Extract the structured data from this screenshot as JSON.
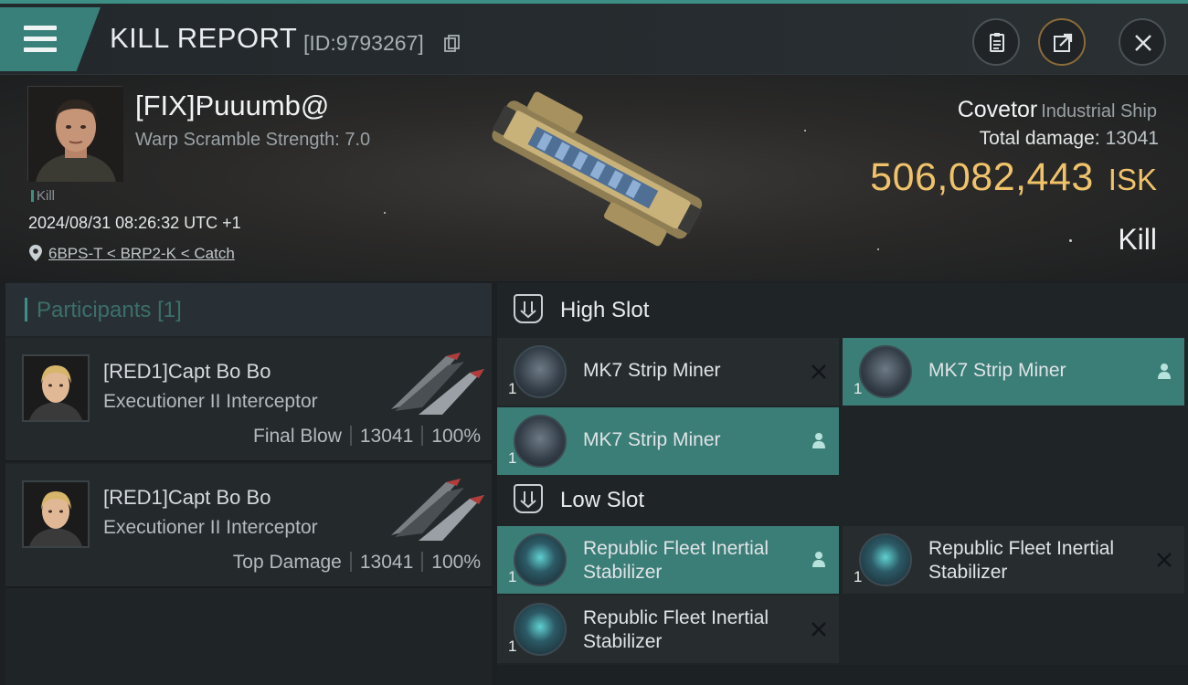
{
  "header": {
    "title": "KILL REPORT",
    "id_text": "[ID:9793267]"
  },
  "victim": {
    "name": "[FIX]Puuumb@",
    "warp_info": "Warp Scramble Strength: 7.0",
    "kill_tag": "Kill",
    "timestamp": "2024/08/31 08:26:32 UTC +1",
    "location": "6BPS-T < BRP2-K < Catch",
    "ship_name": "Covetor",
    "ship_class": "Industrial Ship",
    "total_damage_label": "Total damage:",
    "total_damage": "13041",
    "isk_value": "506,082,443",
    "isk_unit": "ISK",
    "result": "Kill"
  },
  "participants": {
    "label": "Participants",
    "count": "[1]",
    "items": [
      {
        "name": "[RED1]Capt Bo Bo",
        "ship": "Executioner II Interceptor",
        "role": "Final Blow",
        "damage": "13041",
        "percent": "100%"
      },
      {
        "name": "[RED1]Capt Bo Bo",
        "ship": "Executioner II Interceptor",
        "role": "Top Damage",
        "damage": "13041",
        "percent": "100%"
      }
    ]
  },
  "slots": {
    "high": {
      "label": "High Slot",
      "modules": [
        {
          "name": "MK7 Strip Miner",
          "qty": "1",
          "status": "destroyed-x-icon",
          "highlighted": false
        },
        {
          "name": "MK7 Strip Miner",
          "qty": "1",
          "status": "dropped-person-icon",
          "highlighted": true
        },
        {
          "name": "MK7 Strip Miner",
          "qty": "1",
          "status": "dropped-person-icon",
          "highlighted": true
        }
      ]
    },
    "low": {
      "label": "Low Slot",
      "modules": [
        {
          "name_line1": "Republic Fleet Inertial",
          "name_line2": "Stabilizer",
          "qty": "1",
          "status": "dropped-person-icon",
          "highlighted": true
        },
        {
          "name_line1": "Republic Fleet Inertial",
          "name_line2": "Stabilizer",
          "qty": "1",
          "status": "destroyed-x-icon",
          "highlighted": false
        },
        {
          "name_line1": "Republic Fleet Inertial",
          "name_line2": "Stabilizer",
          "qty": "1",
          "status": "destroyed-x-icon",
          "highlighted": false
        }
      ]
    }
  },
  "colors": {
    "accent": "#3d8f86",
    "isk": "#f0c36a",
    "highlight": "#3b7d77",
    "panel": "#1f2427"
  }
}
